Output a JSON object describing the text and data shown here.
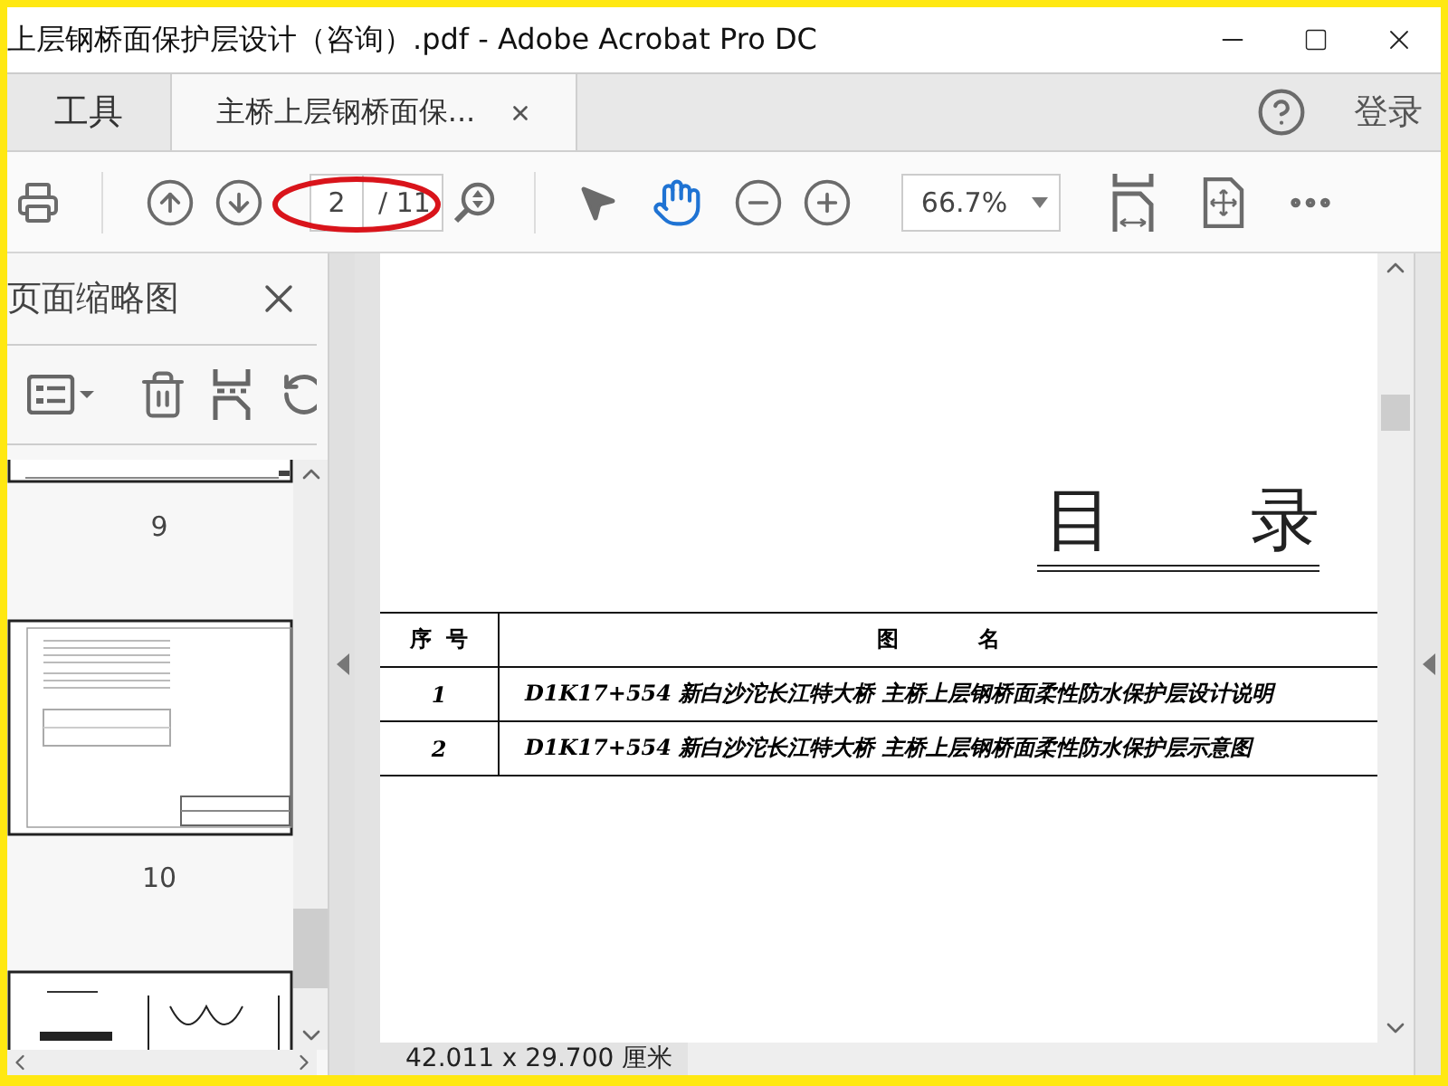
{
  "window": {
    "title": "上层钢桥面保护层设计（咨询）.pdf - Adobe Acrobat Pro DC"
  },
  "tabs": [
    {
      "label": "工具",
      "kind": "home",
      "selected": false
    },
    {
      "label": "主桥上层钢桥面保...",
      "kind": "document",
      "selected": true
    }
  ],
  "account": {
    "login": "登录"
  },
  "toolbar": {
    "page_current": "2",
    "page_total": "/ 11",
    "zoom": "66.7%"
  },
  "sidebar": {
    "title": "页面缩略图",
    "thumbnails": [
      {
        "kind": "tail",
        "label": "9"
      },
      {
        "kind": "text-page",
        "label": "10"
      },
      {
        "kind": "drawing-page"
      }
    ]
  },
  "document": {
    "heading": "目 录",
    "columns": [
      "序 号",
      "图 名"
    ],
    "rows": [
      {
        "number": "1",
        "name": "D1K17+554 新白沙沱长江特大桥 主桥上层钢桥面柔性防水保护层设计说明"
      },
      {
        "number": "2",
        "name": "D1K17+554 新白沙沱长江特大桥 主桥上层钢桥面柔性防水保护层示意图"
      }
    ]
  },
  "status_bar": {
    "page_size": "42.011 x 29.700 厘米"
  }
}
